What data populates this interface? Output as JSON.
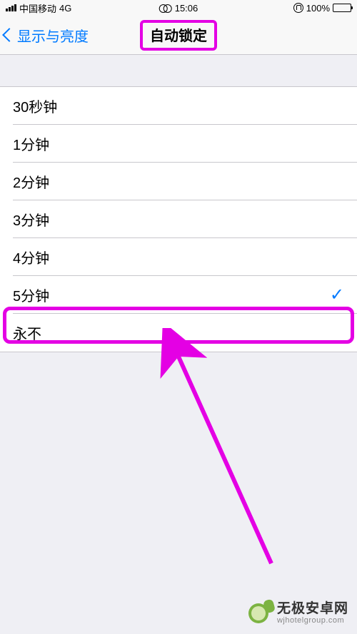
{
  "statusBar": {
    "carrier": "中国移动",
    "network": "4G",
    "time": "15:06",
    "batteryPercent": "100%"
  },
  "nav": {
    "backLabel": "显示与亮度",
    "title": "自动锁定"
  },
  "options": [
    {
      "label": "30秒钟",
      "selected": false
    },
    {
      "label": "1分钟",
      "selected": false
    },
    {
      "label": "2分钟",
      "selected": false
    },
    {
      "label": "3分钟",
      "selected": false
    },
    {
      "label": "4分钟",
      "selected": false
    },
    {
      "label": "5分钟",
      "selected": true
    },
    {
      "label": "永不",
      "selected": false
    }
  ],
  "watermark": {
    "title": "无极安卓网",
    "url": "wjhotelgroup.com"
  },
  "annotation": {
    "titleHighlighted": true,
    "rowHighlightedIndex": 6,
    "arrowColor": "#e400e4"
  }
}
